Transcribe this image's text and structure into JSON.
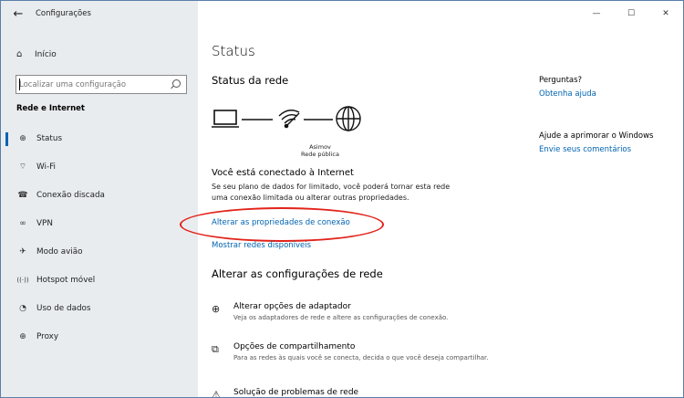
{
  "window": {
    "app_title": "Configurações",
    "back_glyph": "←",
    "minimize_glyph": "—",
    "maximize_glyph": "☐",
    "close_glyph": "✕"
  },
  "sidebar": {
    "home_label": "Início",
    "search": {
      "placeholder": "Localizar uma configuração",
      "value": ""
    },
    "section_label": "Rede e Internet",
    "items": [
      {
        "label": "Status",
        "icon": "globe-status-icon",
        "glyph": "⊕",
        "selected": true
      },
      {
        "label": "Wi-Fi",
        "icon": "wifi-icon",
        "glyph": "⌔",
        "selected": false
      },
      {
        "label": "Conexão discada",
        "icon": "dialup-icon",
        "glyph": "☎",
        "selected": false
      },
      {
        "label": "VPN",
        "icon": "vpn-icon",
        "glyph": "∞",
        "selected": false
      },
      {
        "label": "Modo avião",
        "icon": "airplane-icon",
        "glyph": "✈",
        "selected": false
      },
      {
        "label": "Hotspot móvel",
        "icon": "hotspot-icon",
        "glyph": "((·))",
        "selected": false
      },
      {
        "label": "Uso de dados",
        "icon": "data-usage-icon",
        "glyph": "◔",
        "selected": false
      },
      {
        "label": "Proxy",
        "icon": "proxy-icon",
        "glyph": "⊕",
        "selected": false
      }
    ]
  },
  "main": {
    "title": "Status",
    "network_heading": "Status da rede",
    "network": {
      "name": "Asimov",
      "type": "Rede pública"
    },
    "connected_title": "Você está conectado à Internet",
    "connected_desc": "Se seu plano de dados for limitado, você poderá tornar esta rede uma conexão limitada ou alterar outras propriedades.",
    "link_properties": "Alterar as propriedades de conexão",
    "link_show_networks": "Mostrar redes disponíveis",
    "change_heading": "Alterar as configurações de rede",
    "options": [
      {
        "title": "Alterar opções de adaptador",
        "desc": "Veja os adaptadores de rede e altere as configurações de conexão."
      },
      {
        "title": "Opções de compartilhamento",
        "desc": "Para as redes às quais você se conecta, decida o que você deseja compartilhar."
      },
      {
        "title": "Solução de problemas de rede",
        "desc": ""
      }
    ]
  },
  "right": {
    "questions": "Perguntas?",
    "get_help": "Obtenha ajuda",
    "improve": "Ajude a aprimorar o Windows",
    "feedback": "Envie seus comentários"
  },
  "colors": {
    "accent": "#0063b1",
    "sidebar_bg": "#e9ecef",
    "annotation": "#e2231a"
  }
}
